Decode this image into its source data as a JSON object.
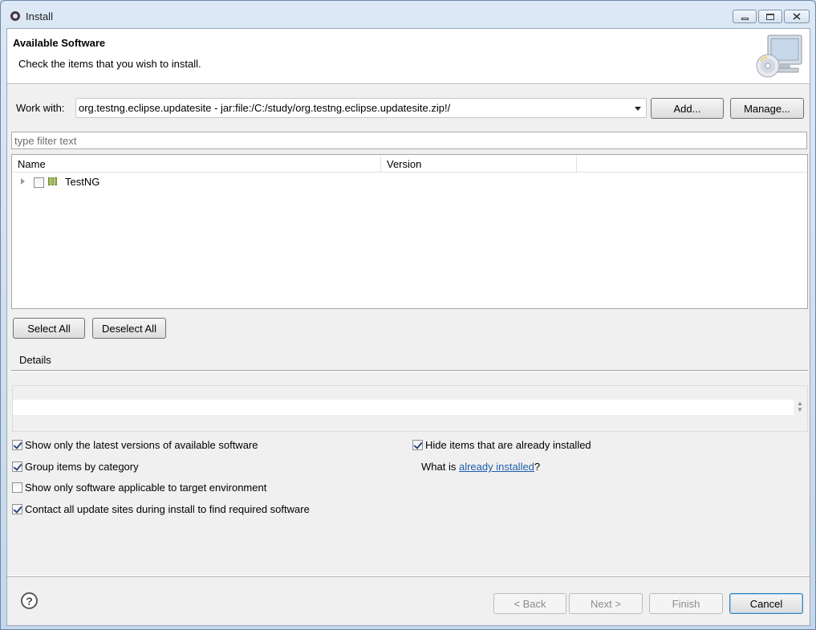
{
  "window": {
    "title": "Install",
    "controls": [
      "minimize-icon",
      "maximize-icon",
      "close-icon"
    ]
  },
  "banner": {
    "title": "Available Software",
    "message": "Check the items that you wish to install.",
    "image": "install-disc-monitor-icon"
  },
  "work_with": {
    "label": "Work with:",
    "value": "org.testng.eclipse.updatesite - jar:file:/C:/study/org.testng.eclipse.updatesite.zip!/",
    "add_label": "Add...",
    "manage_label": "Manage..."
  },
  "filter": {
    "placeholder": "type filter text",
    "value": ""
  },
  "tree": {
    "columns": [
      "Name",
      "Version",
      ""
    ],
    "rows": [
      {
        "name": "TestNG",
        "version": "",
        "checked": false,
        "expanded": false
      }
    ]
  },
  "selection": {
    "select_all_label": "Select All",
    "deselect_all_label": "Deselect All"
  },
  "details": {
    "label": "Details",
    "text": ""
  },
  "options": {
    "latest_versions": {
      "label": "Show only the latest versions of available software",
      "checked": true
    },
    "group_by_category": {
      "label": "Group items by category",
      "checked": true
    },
    "applicable_only": {
      "label": "Show only software applicable to target environment",
      "checked": false
    },
    "contact_sites": {
      "label": "Contact all update sites during install to find required software",
      "checked": true
    },
    "hide_installed": {
      "label": "Hide items that are already installed",
      "checked": true
    },
    "what_is_prefix": "What is ",
    "what_is_link": "already installed",
    "what_is_suffix": "?"
  },
  "footer": {
    "help_icon": "help-icon",
    "help_glyph": "?",
    "back_label": "< Back",
    "next_label": "Next >",
    "finish_label": "Finish",
    "cancel_label": "Cancel"
  }
}
